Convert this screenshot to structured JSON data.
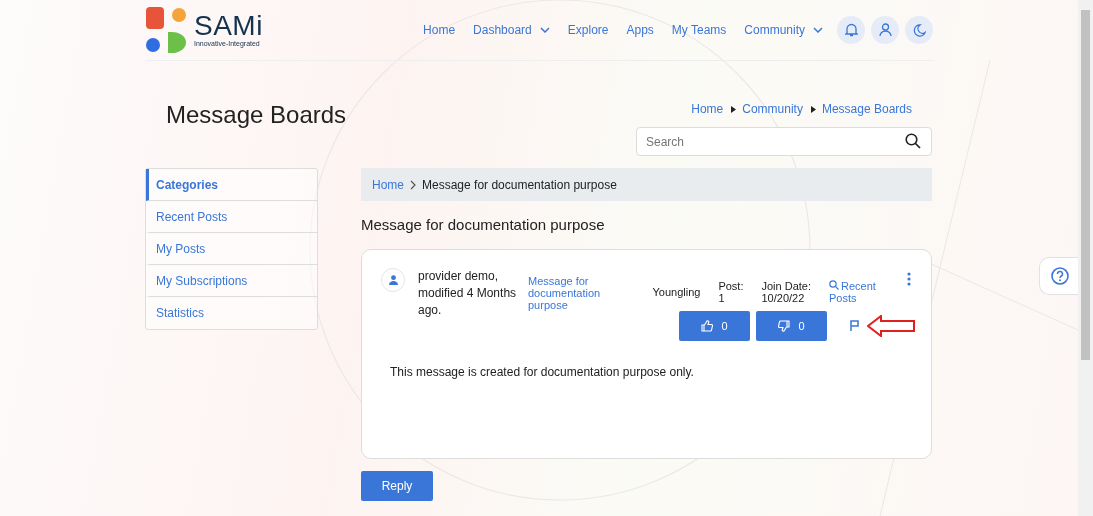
{
  "logo": {
    "name": "SAMi",
    "tagline": "Innovative-Integrated"
  },
  "nav": [
    {
      "label": "Home",
      "kind": "link"
    },
    {
      "label": "Dashboard",
      "kind": "dropdown"
    },
    {
      "label": "Explore",
      "kind": "link"
    },
    {
      "label": "Apps",
      "kind": "link"
    },
    {
      "label": "My Teams",
      "kind": "link"
    },
    {
      "label": "Community",
      "kind": "dropdown"
    }
  ],
  "page_title": "Message Boards",
  "breadcrumb": [
    "Home",
    "Community",
    "Message Boards"
  ],
  "search": {
    "placeholder": "Search"
  },
  "sidebar": {
    "items": [
      {
        "label": "Categories",
        "selected": true
      },
      {
        "label": "Recent Posts",
        "selected": false
      },
      {
        "label": "My Posts",
        "selected": false
      },
      {
        "label": "My Subscriptions",
        "selected": false
      },
      {
        "label": "Statistics",
        "selected": false
      }
    ]
  },
  "thread_breadcrumb": {
    "link": "Home",
    "current": "Message for documentation purpose"
  },
  "thread_title": "Message for documentation purpose",
  "post": {
    "author_line": "provider demo, modified 4 Months ago.",
    "subject": "Message for documentation purpose",
    "rank": "Youngling",
    "post_label": "Post:",
    "post_count": "1",
    "join_label": "Join Date:",
    "join_date": "10/20/22",
    "recent_posts": "Recent Posts",
    "likes": "0",
    "dislikes": "0",
    "body": "This message is created for documentation purpose only."
  },
  "reply_button": "Reply"
}
